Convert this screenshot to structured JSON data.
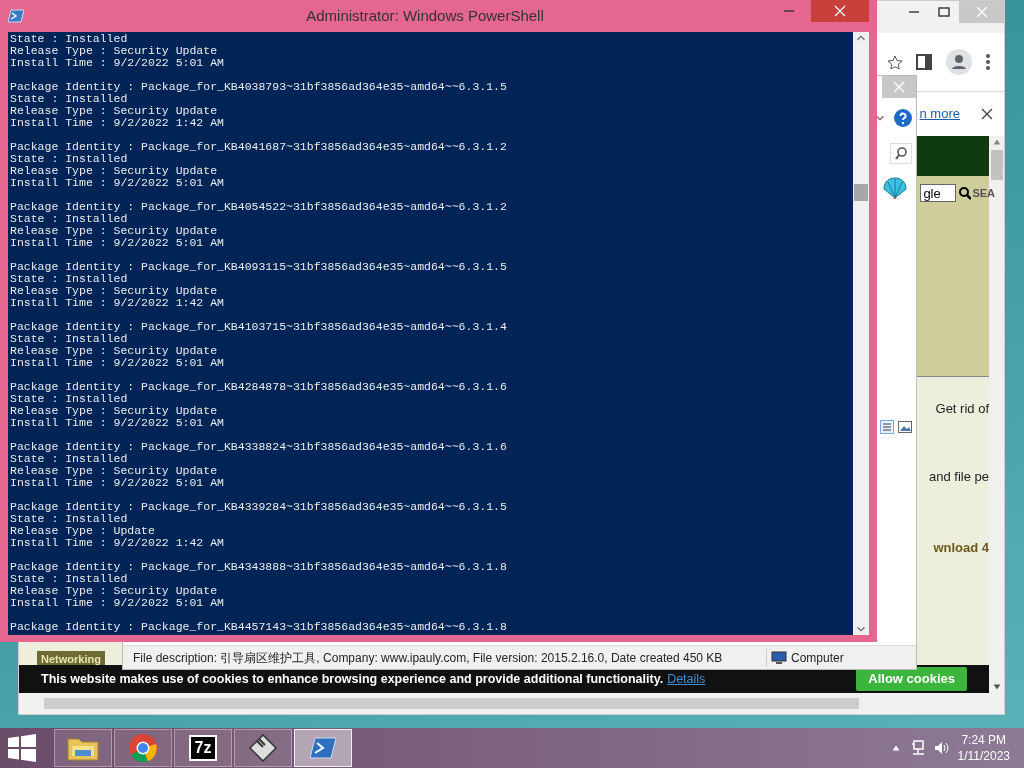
{
  "powershell": {
    "title": "Administrator: Windows PowerShell",
    "records": [
      {
        "lines": [
          "State : Installed",
          "Release Type : Security Update",
          "Install Time : 9/2/2022 5:01 AM"
        ]
      },
      {
        "lines": [
          "Package Identity : Package_for_KB4038793~31bf3856ad364e35~amd64~~6.3.1.5",
          "State : Installed",
          "Release Type : Security Update",
          "Install Time : 9/2/2022 1:42 AM"
        ]
      },
      {
        "lines": [
          "Package Identity : Package_for_KB4041687~31bf3856ad364e35~amd64~~6.3.1.2",
          "State : Installed",
          "Release Type : Security Update",
          "Install Time : 9/2/2022 5:01 AM"
        ]
      },
      {
        "lines": [
          "Package Identity : Package_for_KB4054522~31bf3856ad364e35~amd64~~6.3.1.2",
          "State : Installed",
          "Release Type : Security Update",
          "Install Time : 9/2/2022 5:01 AM"
        ]
      },
      {
        "lines": [
          "Package Identity : Package_for_KB4093115~31bf3856ad364e35~amd64~~6.3.1.5",
          "State : Installed",
          "Release Type : Security Update",
          "Install Time : 9/2/2022 1:42 AM"
        ]
      },
      {
        "lines": [
          "Package Identity : Package_for_KB4103715~31bf3856ad364e35~amd64~~6.3.1.4",
          "State : Installed",
          "Release Type : Security Update",
          "Install Time : 9/2/2022 5:01 AM"
        ]
      },
      {
        "lines": [
          "Package Identity : Package_for_KB4284878~31bf3856ad364e35~amd64~~6.3.1.6",
          "State : Installed",
          "Release Type : Security Update",
          "Install Time : 9/2/2022 5:01 AM"
        ]
      },
      {
        "lines": [
          "Package Identity : Package_for_KB4338824~31bf3856ad364e35~amd64~~6.3.1.6",
          "State : Installed",
          "Release Type : Security Update",
          "Install Time : 9/2/2022 5:01 AM"
        ]
      },
      {
        "lines": [
          "Package Identity : Package_for_KB4339284~31bf3856ad364e35~amd64~~6.3.1.5",
          "State : Installed",
          "Release Type : Update",
          "Install Time : 9/2/2022 1:42 AM"
        ]
      },
      {
        "lines": [
          "Package Identity : Package_for_KB4343888~31bf3856ad364e35~amd64~~6.3.1.8",
          "State : Installed",
          "Release Type : Security Update",
          "Install Time : 9/2/2022 5:01 AM"
        ]
      },
      {
        "lines": [
          "Package Identity : Package_for_KB4457143~31bf3856ad364e35~amd64~~6.3.1.8"
        ]
      }
    ]
  },
  "browser": {
    "infobar_link": "n more",
    "search_value": "gle",
    "search_button": "SEA",
    "texts": [
      "Get rid of",
      "and file pe",
      "wnload 4"
    ],
    "sidebar_link": "Networking",
    "cookie_bar": {
      "message": "This website makes use of cookies to enhance browsing experience and provide additional functionality.",
      "link": "Details",
      "button": "Allow cookies"
    }
  },
  "file_window": {
    "status_bar": {
      "description": "File description: 引导扇区维护工具, Company: www.ipauly.com, File version: 2015.2.16.0, Date created 450 KB",
      "zone": "Computer"
    }
  },
  "taskbar": {
    "apps": [
      {
        "kind": "folder",
        "selected": false
      },
      {
        "kind": "chrome",
        "selected": false
      },
      {
        "kind": "archiver",
        "label": "7z",
        "selected": false
      },
      {
        "kind": "floppy",
        "selected": false
      },
      {
        "kind": "shell",
        "selected": true
      }
    ],
    "time": "7:24 PM",
    "date": "1/11/2023"
  }
}
